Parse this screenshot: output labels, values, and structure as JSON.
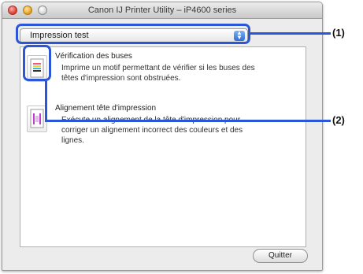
{
  "window": {
    "title": "Canon IJ Printer Utility – iP4600 series"
  },
  "popup": {
    "selected": "Impression test"
  },
  "items": [
    {
      "title": "Vérification des buses",
      "desc": "Imprime un motif permettant de vérifier si les buses des têtes d'impression sont obstruées."
    },
    {
      "title": "Alignement tête d'impression",
      "desc": "Exécute un alignement de la tête d'impression pour corriger un alignement incorrect des couleurs et des lignes."
    }
  ],
  "buttons": {
    "quit": "Quitter"
  },
  "callouts": {
    "one": "(1)",
    "two": "(2)"
  },
  "colors": {
    "callout": "#2b57d6"
  }
}
